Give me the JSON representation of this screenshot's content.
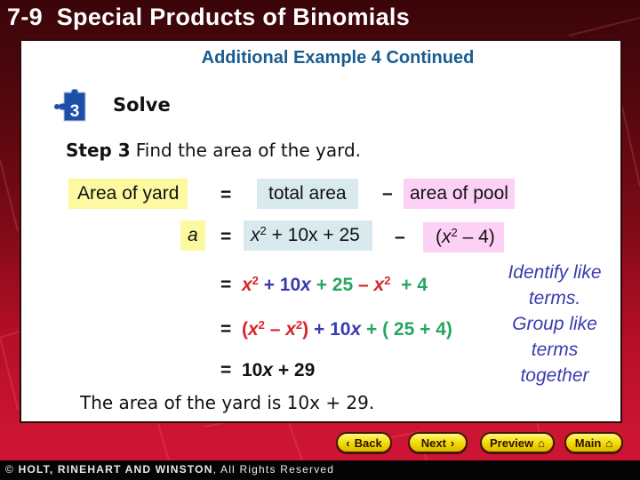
{
  "slide": {
    "number": "7-9",
    "title": "Special Products of Binomials",
    "subtitle": "Additional Example 4 Continued",
    "step_badge": {
      "icon": "puzzle-piece-icon",
      "number": "3",
      "color": "#1e4fa8"
    },
    "step_heading": "Solve"
  },
  "step3": {
    "label": "Step 3",
    "text": "Find the area of the yard."
  },
  "word_equation": {
    "left": "Area of yard",
    "equals": "=",
    "term1": "total area",
    "minus": "–",
    "term2": "area of pool"
  },
  "symbolic_equation": {
    "left": "a",
    "equals": "=",
    "term1": {
      "var": "x",
      "exp": "2",
      "rest": " + 10x + 25"
    },
    "minus": "–",
    "term2": {
      "open": "(",
      "var": "x",
      "exp": "2",
      "rest": " – 4)"
    }
  },
  "steps": [
    {
      "equals": "=",
      "parts": [
        {
          "text": "x",
          "sup": "2",
          "color": "red"
        },
        {
          "text": " + 10x",
          "color": "indigo"
        },
        {
          "text": " + 25 ",
          "color": "green"
        },
        {
          "text": "– x",
          "sup": "2",
          "color": "red"
        },
        {
          "text": "  + 4",
          "color": "green"
        }
      ]
    },
    {
      "equals": "=",
      "parts": [
        {
          "text": "(x",
          "sup": "2",
          "color": "red"
        },
        {
          "text": " – x",
          "sup": "2",
          "color": "red"
        },
        {
          "text": ")",
          "color": "red"
        },
        {
          "text": " + 10x",
          "color": "indigo"
        },
        {
          "text": " + ( 25 + 4)",
          "color": "green"
        }
      ]
    },
    {
      "equals": "=",
      "parts": [
        {
          "text": "10x + 29",
          "color": "black"
        }
      ]
    }
  ],
  "notes": {
    "identify": [
      "Identify like",
      "terms."
    ],
    "group": [
      "Group like",
      "terms",
      "together"
    ]
  },
  "conclusion": "The area of the yard is 10x + 29.",
  "navigation": {
    "back": {
      "label": "Back",
      "icon": "chevron-left-icon"
    },
    "next": {
      "label": "Next",
      "icon": "chevron-right-icon"
    },
    "preview": {
      "label": "Preview",
      "icon": "home-icon"
    },
    "main": {
      "label": "Main",
      "icon": "home-icon"
    }
  },
  "footer": {
    "copyright_symbol": "©",
    "publisher": "HOLT, RINEHART AND WINSTON",
    "rights": ", All Rights Reserved"
  },
  "colors": {
    "title_text": "#ffffff",
    "subtitle_text": "#1a5c8f",
    "yellow_highlight": "#fcf9a0",
    "blue_highlight": "#d8eaee",
    "pink_highlight": "#fdd0f6",
    "like_term_x2": "#d8242c",
    "like_term_x": "#3b3bb0",
    "like_term_const": "#27a662",
    "note_text": "#3b3bb0",
    "nav_button": "#f3d900"
  }
}
